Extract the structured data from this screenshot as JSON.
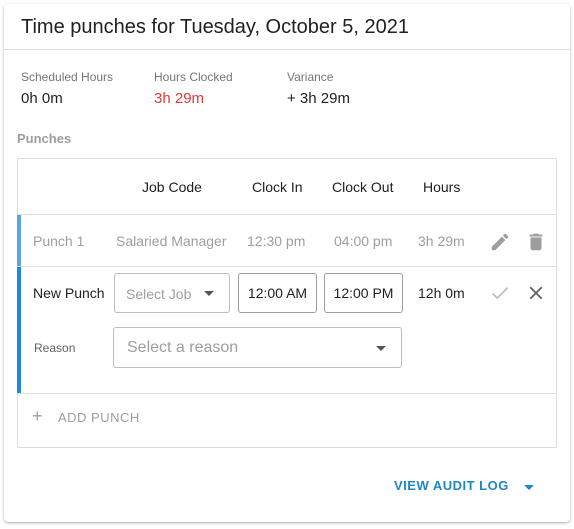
{
  "title": "Time punches for Tuesday, October 5, 2021",
  "summary": {
    "scheduled_label": "Scheduled Hours",
    "scheduled_value": "0h 0m",
    "clocked_label": "Hours Clocked",
    "clocked_value": "3h 29m",
    "variance_label": "Variance",
    "variance_value": "+ 3h 29m"
  },
  "punches_label": "Punches",
  "columns": {
    "job_code": "Job Code",
    "clock_in": "Clock In",
    "clock_out": "Clock Out",
    "hours": "Hours"
  },
  "punch1": {
    "name": "Punch 1",
    "job": "Salaried Manager",
    "clock_in": "12:30 pm",
    "clock_out": "04:00 pm",
    "hours": "3h 29m",
    "edit_icon": "pencil-icon",
    "delete_icon": "trash-icon"
  },
  "new_punch": {
    "name": "New Punch",
    "job_placeholder": "Select Job",
    "clock_in": "12:00 AM",
    "clock_out": "12:00 PM",
    "hours": "12h 0m",
    "reason_label": "Reason",
    "reason_placeholder": "Select a reason",
    "confirm_icon": "check-icon",
    "cancel_icon": "close-icon"
  },
  "add_punch_label": "ADD PUNCH",
  "view_audit_log_label": "VIEW AUDIT LOG",
  "colors": {
    "accent": "#1e88e5",
    "link": "#1e88c5",
    "clocked_red": "#e53935"
  }
}
